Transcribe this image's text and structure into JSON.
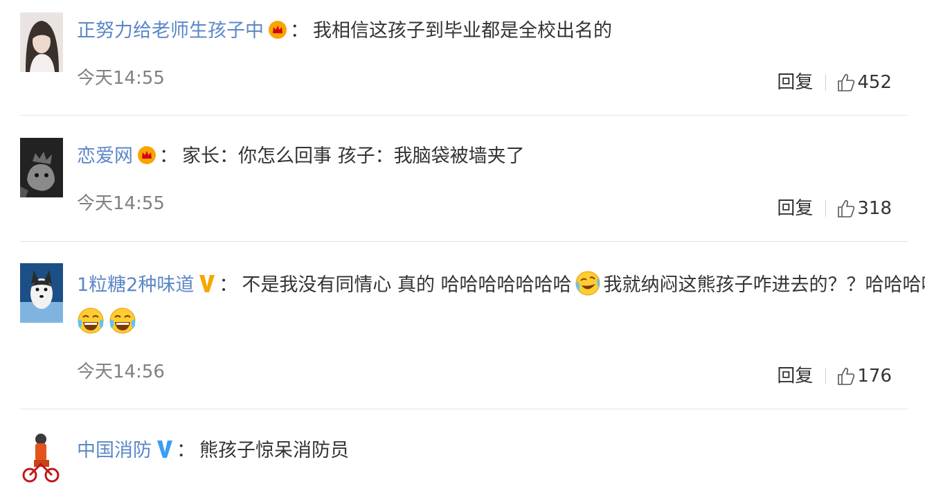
{
  "separator": "：",
  "reply_label": "回复",
  "colors": {
    "username": "#5b87c7",
    "text": "#333333",
    "time": "#808080",
    "vip_orange": "#f7a600",
    "verified_blue": "#3a9ef5"
  },
  "comments": [
    {
      "username": "正努力给老师生孩子中",
      "badge": "crown-icon",
      "text": "我相信这孩子到毕业都是全校出名的",
      "time": "今天14:55",
      "likes": "452"
    },
    {
      "username": "恋爱网",
      "badge": "crown-icon",
      "text": "家长：你怎么回事 孩子：我脑袋被墙夹了",
      "time": "今天14:55",
      "likes": "318"
    },
    {
      "username": "1粒糖2种味道",
      "badge": "verified-v-icon",
      "text_part1": "不是我没有同情心 真的 哈哈哈哈哈哈哈",
      "text_part2": "我就纳闷这熊孩子咋进去的？？哈哈哈哈",
      "emojis": [
        "crying-laughing-tilted-emoji",
        "laugh-cry-emoji",
        "laugh-cry-emoji"
      ],
      "time": "今天14:56",
      "likes": "176"
    },
    {
      "username": "中国消防",
      "badge": "verified-v-icon",
      "text": "熊孩子惊呆消防员"
    }
  ]
}
